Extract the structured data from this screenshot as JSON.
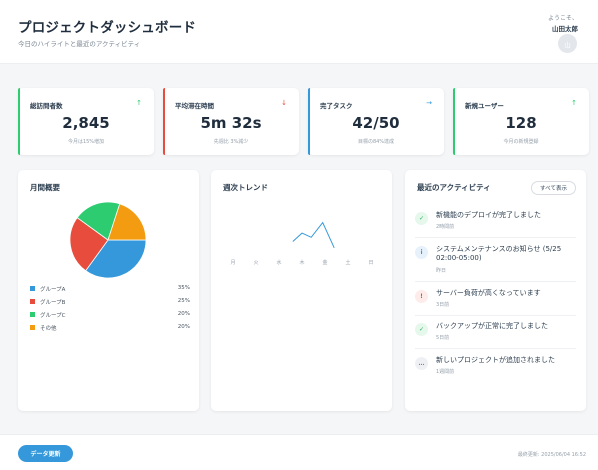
{
  "header": {
    "title": "プロジェクトダッシュボード",
    "subtitle": "今日のハイライトと最近のアクティビティ",
    "welcome": "ようこそ、",
    "username": "山田太郎",
    "avatar_text": "山"
  },
  "stats": [
    {
      "label": "総訪問者数",
      "value": "2,845",
      "sub": "今月は15%増加",
      "arrow": "↑",
      "color": "#2ecc71",
      "arrow_color": "#2ecc71"
    },
    {
      "label": "平均滞在時間",
      "value": "5m 32s",
      "sub": "先週比 3%減少",
      "arrow": "↓",
      "color": "#e74c3c",
      "arrow_color": "#e74c3c"
    },
    {
      "label": "完了タスク",
      "value": "42/50",
      "sub": "目標の84%達成",
      "arrow": "→",
      "color": "#3498db",
      "arrow_color": "#3498db"
    },
    {
      "label": "新規ユーザー",
      "value": "128",
      "sub": "今月の新規登録",
      "arrow": "↑",
      "color": "#2ecc71",
      "arrow_color": "#2ecc71"
    }
  ],
  "monthly": {
    "title": "月間概要",
    "legend": [
      {
        "name": "グループA",
        "pct": "35%"
      },
      {
        "name": "グループB",
        "pct": "25%"
      },
      {
        "name": "グループC",
        "pct": "20%"
      },
      {
        "name": "その他",
        "pct": "20%"
      }
    ]
  },
  "weekly": {
    "title": "週次トレンド"
  },
  "chart_data": [
    {
      "type": "pie",
      "title": "月間概要",
      "categories": [
        "グループA",
        "グループB",
        "グループC",
        "その他"
      ],
      "values": [
        35,
        25,
        20,
        20
      ],
      "colors": [
        "#3498db",
        "#e74c3c",
        "#2ecc71",
        "#f39c12"
      ],
      "legend": "bottom"
    },
    {
      "type": "line",
      "title": "週次トレンド",
      "categories": [
        "月",
        "火",
        "水",
        "木",
        "金",
        "土",
        "日"
      ],
      "series": [
        {
          "values": [
            null,
            null,
            40,
            65,
            35,
            null,
            null
          ],
          "detail": [
            [
              2.6,
              25
            ],
            [
              3.0,
              45
            ],
            [
              3.4,
              35
            ],
            [
              3.9,
              70
            ],
            [
              4.4,
              10
            ]
          ]
        }
      ],
      "colors": [
        "#3498db"
      ],
      "grid": false
    }
  ],
  "activity": {
    "title": "最近のアクティビティ",
    "view_all": "すべて表示",
    "items": [
      {
        "icon": "✓",
        "icon_name": "check-icon",
        "bg": "#e6f7ec",
        "fg": "#27ae60",
        "text": "新機能のデプロイが完了しました",
        "time": "2時間前"
      },
      {
        "icon": "i",
        "icon_name": "info-icon",
        "bg": "#e6f1fb",
        "fg": "#3498db",
        "text": "システムメンテナンスのお知らせ (5/25 02:00-05:00)",
        "time": "昨日"
      },
      {
        "icon": "!",
        "icon_name": "warning-icon",
        "bg": "#fdecea",
        "fg": "#e74c3c",
        "text": "サーバー負荷が高くなっています",
        "time": "3日前"
      },
      {
        "icon": "✓",
        "icon_name": "check-icon",
        "bg": "#e6f7ec",
        "fg": "#27ae60",
        "text": "バックアップが正常に完了しました",
        "time": "5日前"
      },
      {
        "icon": "…",
        "icon_name": "more-icon",
        "bg": "#eef0f3",
        "fg": "#7b8794",
        "text": "新しいプロジェクトが追加されました",
        "time": "1週間前"
      }
    ]
  },
  "footer": {
    "refresh_label": "データ更新",
    "last_updated": "最終更新: 2025/06/04 16:52"
  }
}
